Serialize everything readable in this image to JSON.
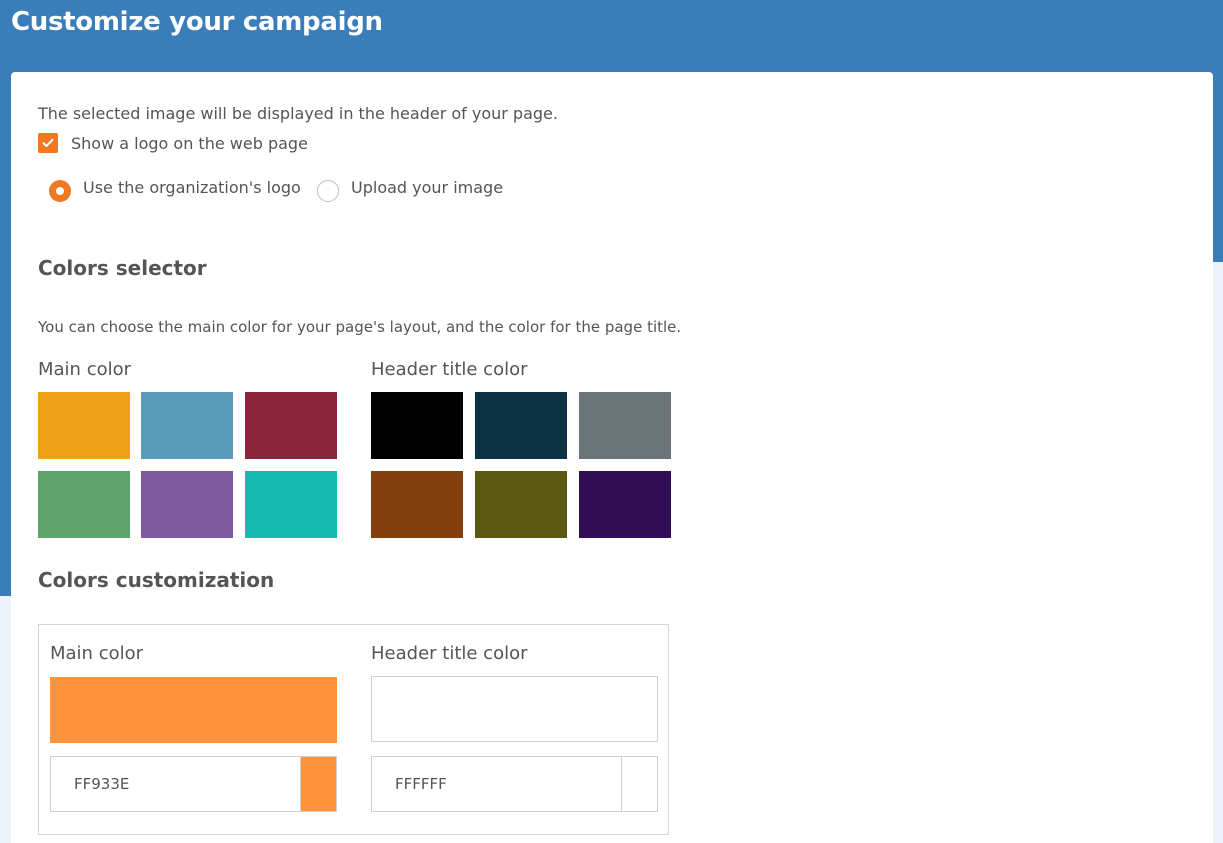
{
  "header": {
    "title": "Customize your campaign"
  },
  "logo_section": {
    "description": "The selected image will be displayed in the header of your page.",
    "show_logo_checkbox": {
      "label": "Show a logo on the web page",
      "checked": true
    },
    "radio_options": [
      {
        "label": "Use the organization's logo",
        "selected": true
      },
      {
        "label": "Upload your image",
        "selected": false
      }
    ]
  },
  "colors_selector": {
    "heading": "Colors selector",
    "description": "You can choose the main color for your page's layout, and the color for the page title.",
    "main_color_label": "Main color",
    "header_title_color_label": "Header title color",
    "main_colors": [
      "#F0A017",
      "#589BBA",
      "#8A2438",
      "#5FA46C",
      "#80589F",
      "#12BAB0"
    ],
    "header_title_colors": [
      "#000000",
      "#0C3244",
      "#6A7479",
      "#843F0F",
      "#5A5811",
      "#320C54"
    ]
  },
  "colors_customization": {
    "heading": "Colors customization",
    "main_color": {
      "label": "Main color",
      "hex": "FF933E",
      "color": "#FF933E"
    },
    "header_title_color": {
      "label": "Header title color",
      "hex": "FFFFFF",
      "color": "#FFFFFF"
    }
  },
  "theme": {
    "header_bg": "#3A7DBB",
    "accent": "#F07822",
    "page_bg": "#EEF2FB"
  }
}
